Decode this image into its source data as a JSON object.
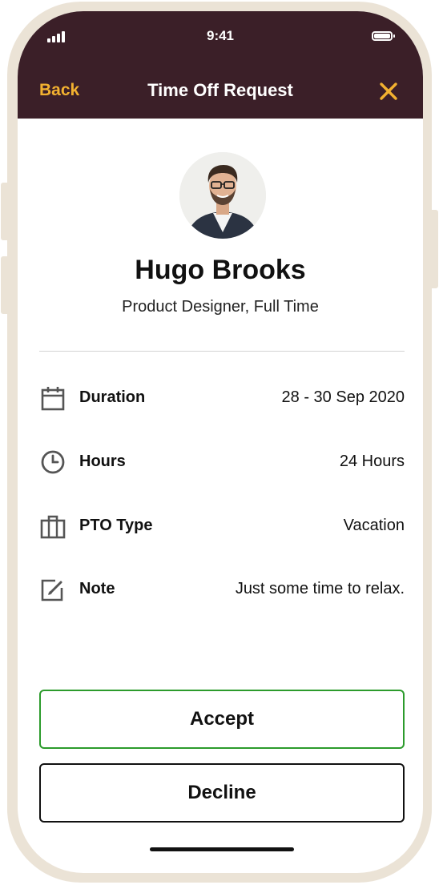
{
  "status_bar": {
    "time": "9:41",
    "signal_icon": "signal-bars-icon",
    "battery_icon": "battery-full-icon"
  },
  "header": {
    "back_label": "Back",
    "title": "Time Off Request",
    "close_icon": "close-x-icon",
    "background_color": "#3b1f28",
    "accent_color": "#f2b130"
  },
  "profile": {
    "name": "Hugo Brooks",
    "role": "Product Designer, Full Time"
  },
  "details": [
    {
      "icon": "calendar-icon",
      "label": "Duration",
      "value": "28 - 30 Sep 2020"
    },
    {
      "icon": "clock-icon",
      "label": "Hours",
      "value": "24 Hours"
    },
    {
      "icon": "suitcase-icon",
      "label": "PTO Type",
      "value": "Vacation"
    },
    {
      "icon": "edit-note-icon",
      "label": "Note",
      "value": "Just some time to relax."
    }
  ],
  "actions": {
    "accept_label": "Accept",
    "decline_label": "Decline",
    "accept_border_color": "#2c9b2c"
  }
}
